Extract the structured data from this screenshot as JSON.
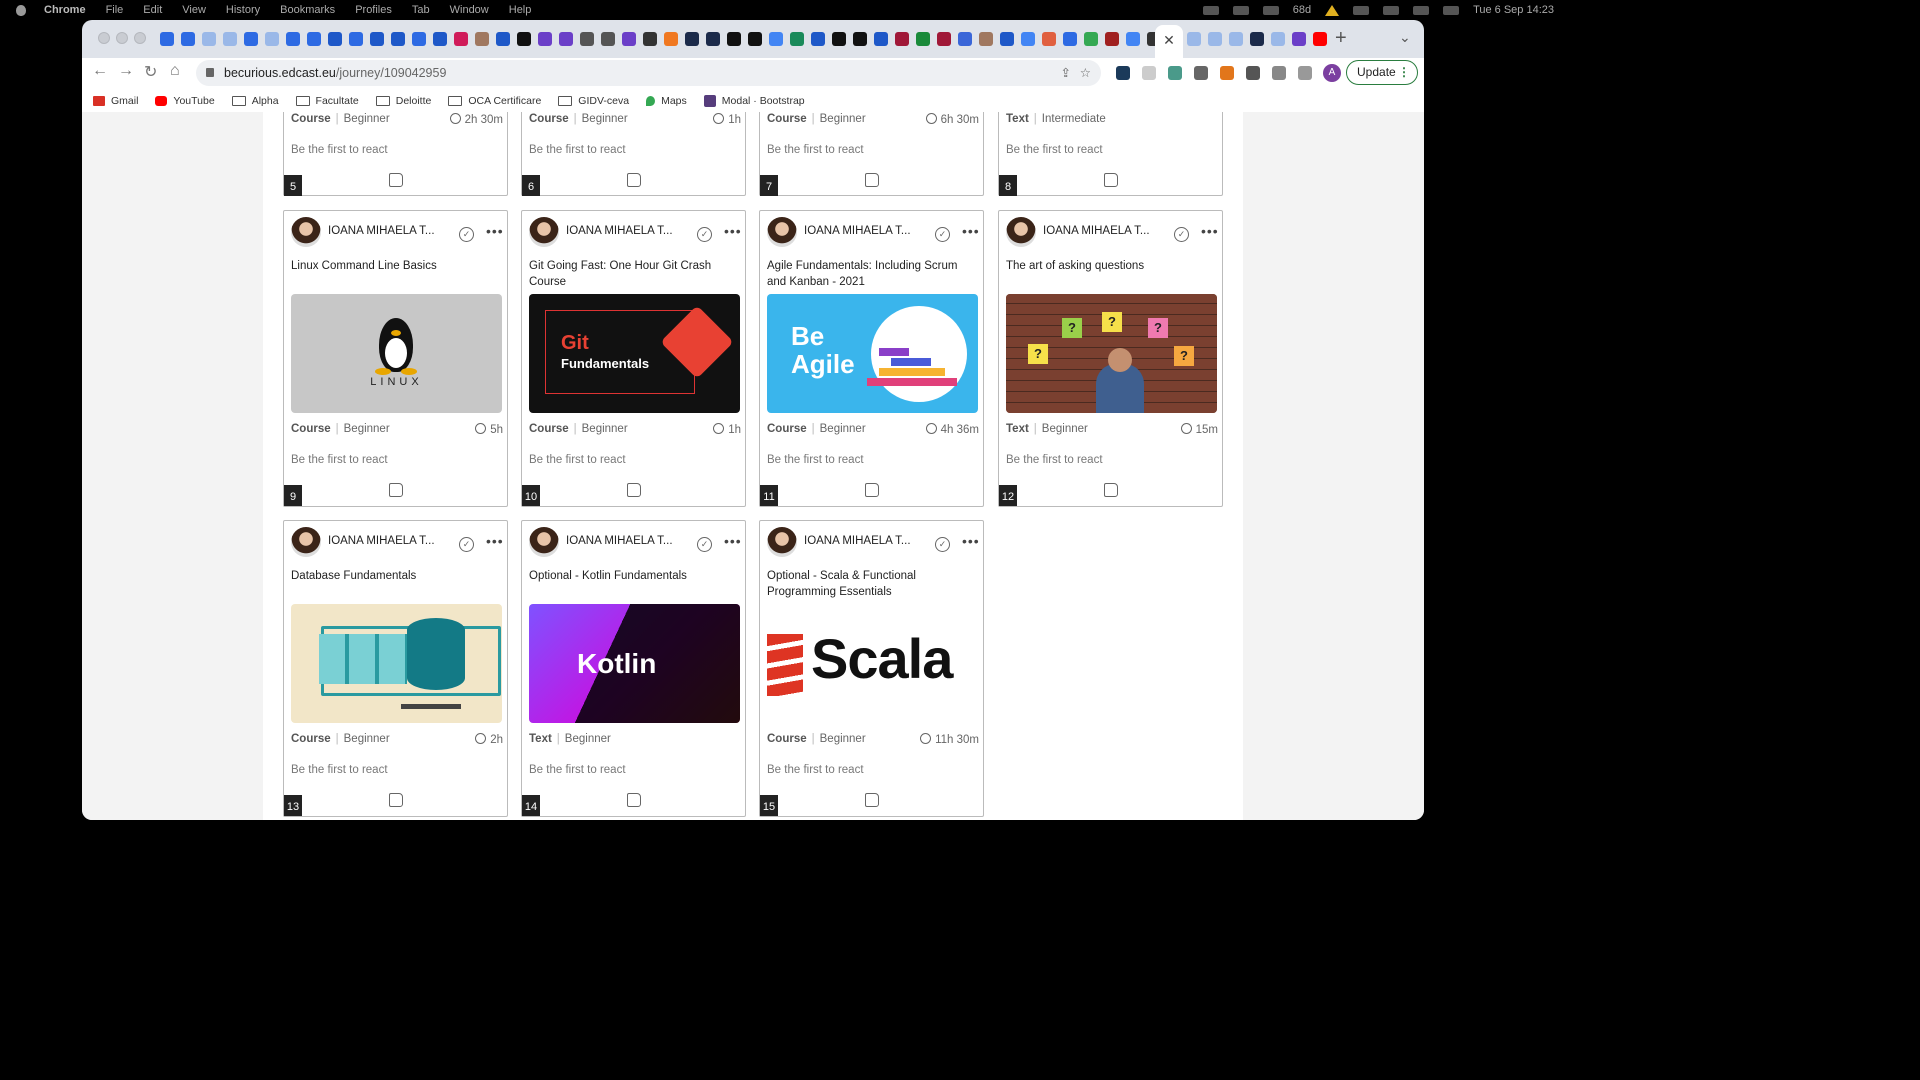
{
  "menubar": {
    "app": "Chrome",
    "items": [
      "File",
      "Edit",
      "View",
      "History",
      "Bookmarks",
      "Profiles",
      "Tab",
      "Window",
      "Help"
    ],
    "status_text": "68d",
    "datetime": "Tue 6 Sep  14:23"
  },
  "browser": {
    "url_host": "becurious.edcast.eu",
    "url_path": "/journey/109042959",
    "active_tab_close": "✕",
    "new_tab": "+",
    "tab_menu": "⌄",
    "profile_initial": "A",
    "update_label": "Update",
    "update_dots": "⋮"
  },
  "bookmarks": [
    {
      "label": "Gmail",
      "icon": "gmail-icon",
      "color": "#d93025"
    },
    {
      "label": "YouTube",
      "icon": "youtube-icon",
      "color": "#ff0000"
    },
    {
      "label": "Alpha",
      "icon": "folder-icon"
    },
    {
      "label": "Facultate",
      "icon": "folder-icon"
    },
    {
      "label": "Deloitte",
      "icon": "folder-icon"
    },
    {
      "label": "OCA Certificare",
      "icon": "folder-icon"
    },
    {
      "label": "GIDV-ceva",
      "icon": "folder-icon"
    },
    {
      "label": "Maps",
      "icon": "maps-icon",
      "color": "#34a853"
    },
    {
      "label": "Modal · Bootstrap",
      "icon": "bootstrap-icon",
      "color": "#563d7c"
    }
  ],
  "react_text": "Be the first to react",
  "author": "IOANA MIHAELA T...",
  "top_row": [
    {
      "type": "Course",
      "level": "Beginner",
      "duration": "2h 30m",
      "number": "5"
    },
    {
      "type": "Course",
      "level": "Beginner",
      "duration": "1h",
      "number": "6"
    },
    {
      "type": "Course",
      "level": "Beginner",
      "duration": "6h 30m",
      "number": "7"
    },
    {
      "type": "Text",
      "level": "Intermediate",
      "duration": "",
      "number": "8"
    }
  ],
  "cards": [
    {
      "title": "Linux Command Line Basics",
      "type": "Course",
      "level": "Beginner",
      "duration": "5h",
      "number": "9",
      "thumb_text": "LINUX"
    },
    {
      "title": "Git Going Fast: One Hour Git Crash Course",
      "type": "Course",
      "level": "Beginner",
      "duration": "1h",
      "number": "10",
      "thumb_text": "Git",
      "thumb_text2": "Fundamentals"
    },
    {
      "title": "Agile Fundamentals: Including Scrum and Kanban - 2021",
      "type": "Course",
      "level": "Beginner",
      "duration": "4h 36m",
      "number": "11",
      "thumb_text": "Be Agile"
    },
    {
      "title": "The art of asking questions",
      "type": "Text",
      "level": "Beginner",
      "duration": "15m",
      "number": "12",
      "thumb_text": "?"
    },
    {
      "title": "Database Fundamentals",
      "type": "Course",
      "level": "Beginner",
      "duration": "2h",
      "number": "13"
    },
    {
      "title": "Optional - Kotlin Fundamentals",
      "type": "Text",
      "level": "Beginner",
      "duration": "",
      "number": "14",
      "thumb_text": "Kotlin"
    },
    {
      "title": "Optional - Scala & Functional Programming Essentials",
      "type": "Course",
      "level": "Beginner",
      "duration": "11h 30m",
      "number": "15",
      "thumb_text": "Scala"
    }
  ],
  "colors": {
    "accent": "#2a7d3f",
    "badge": "#222222",
    "page_bg": "#f3f3f3"
  }
}
